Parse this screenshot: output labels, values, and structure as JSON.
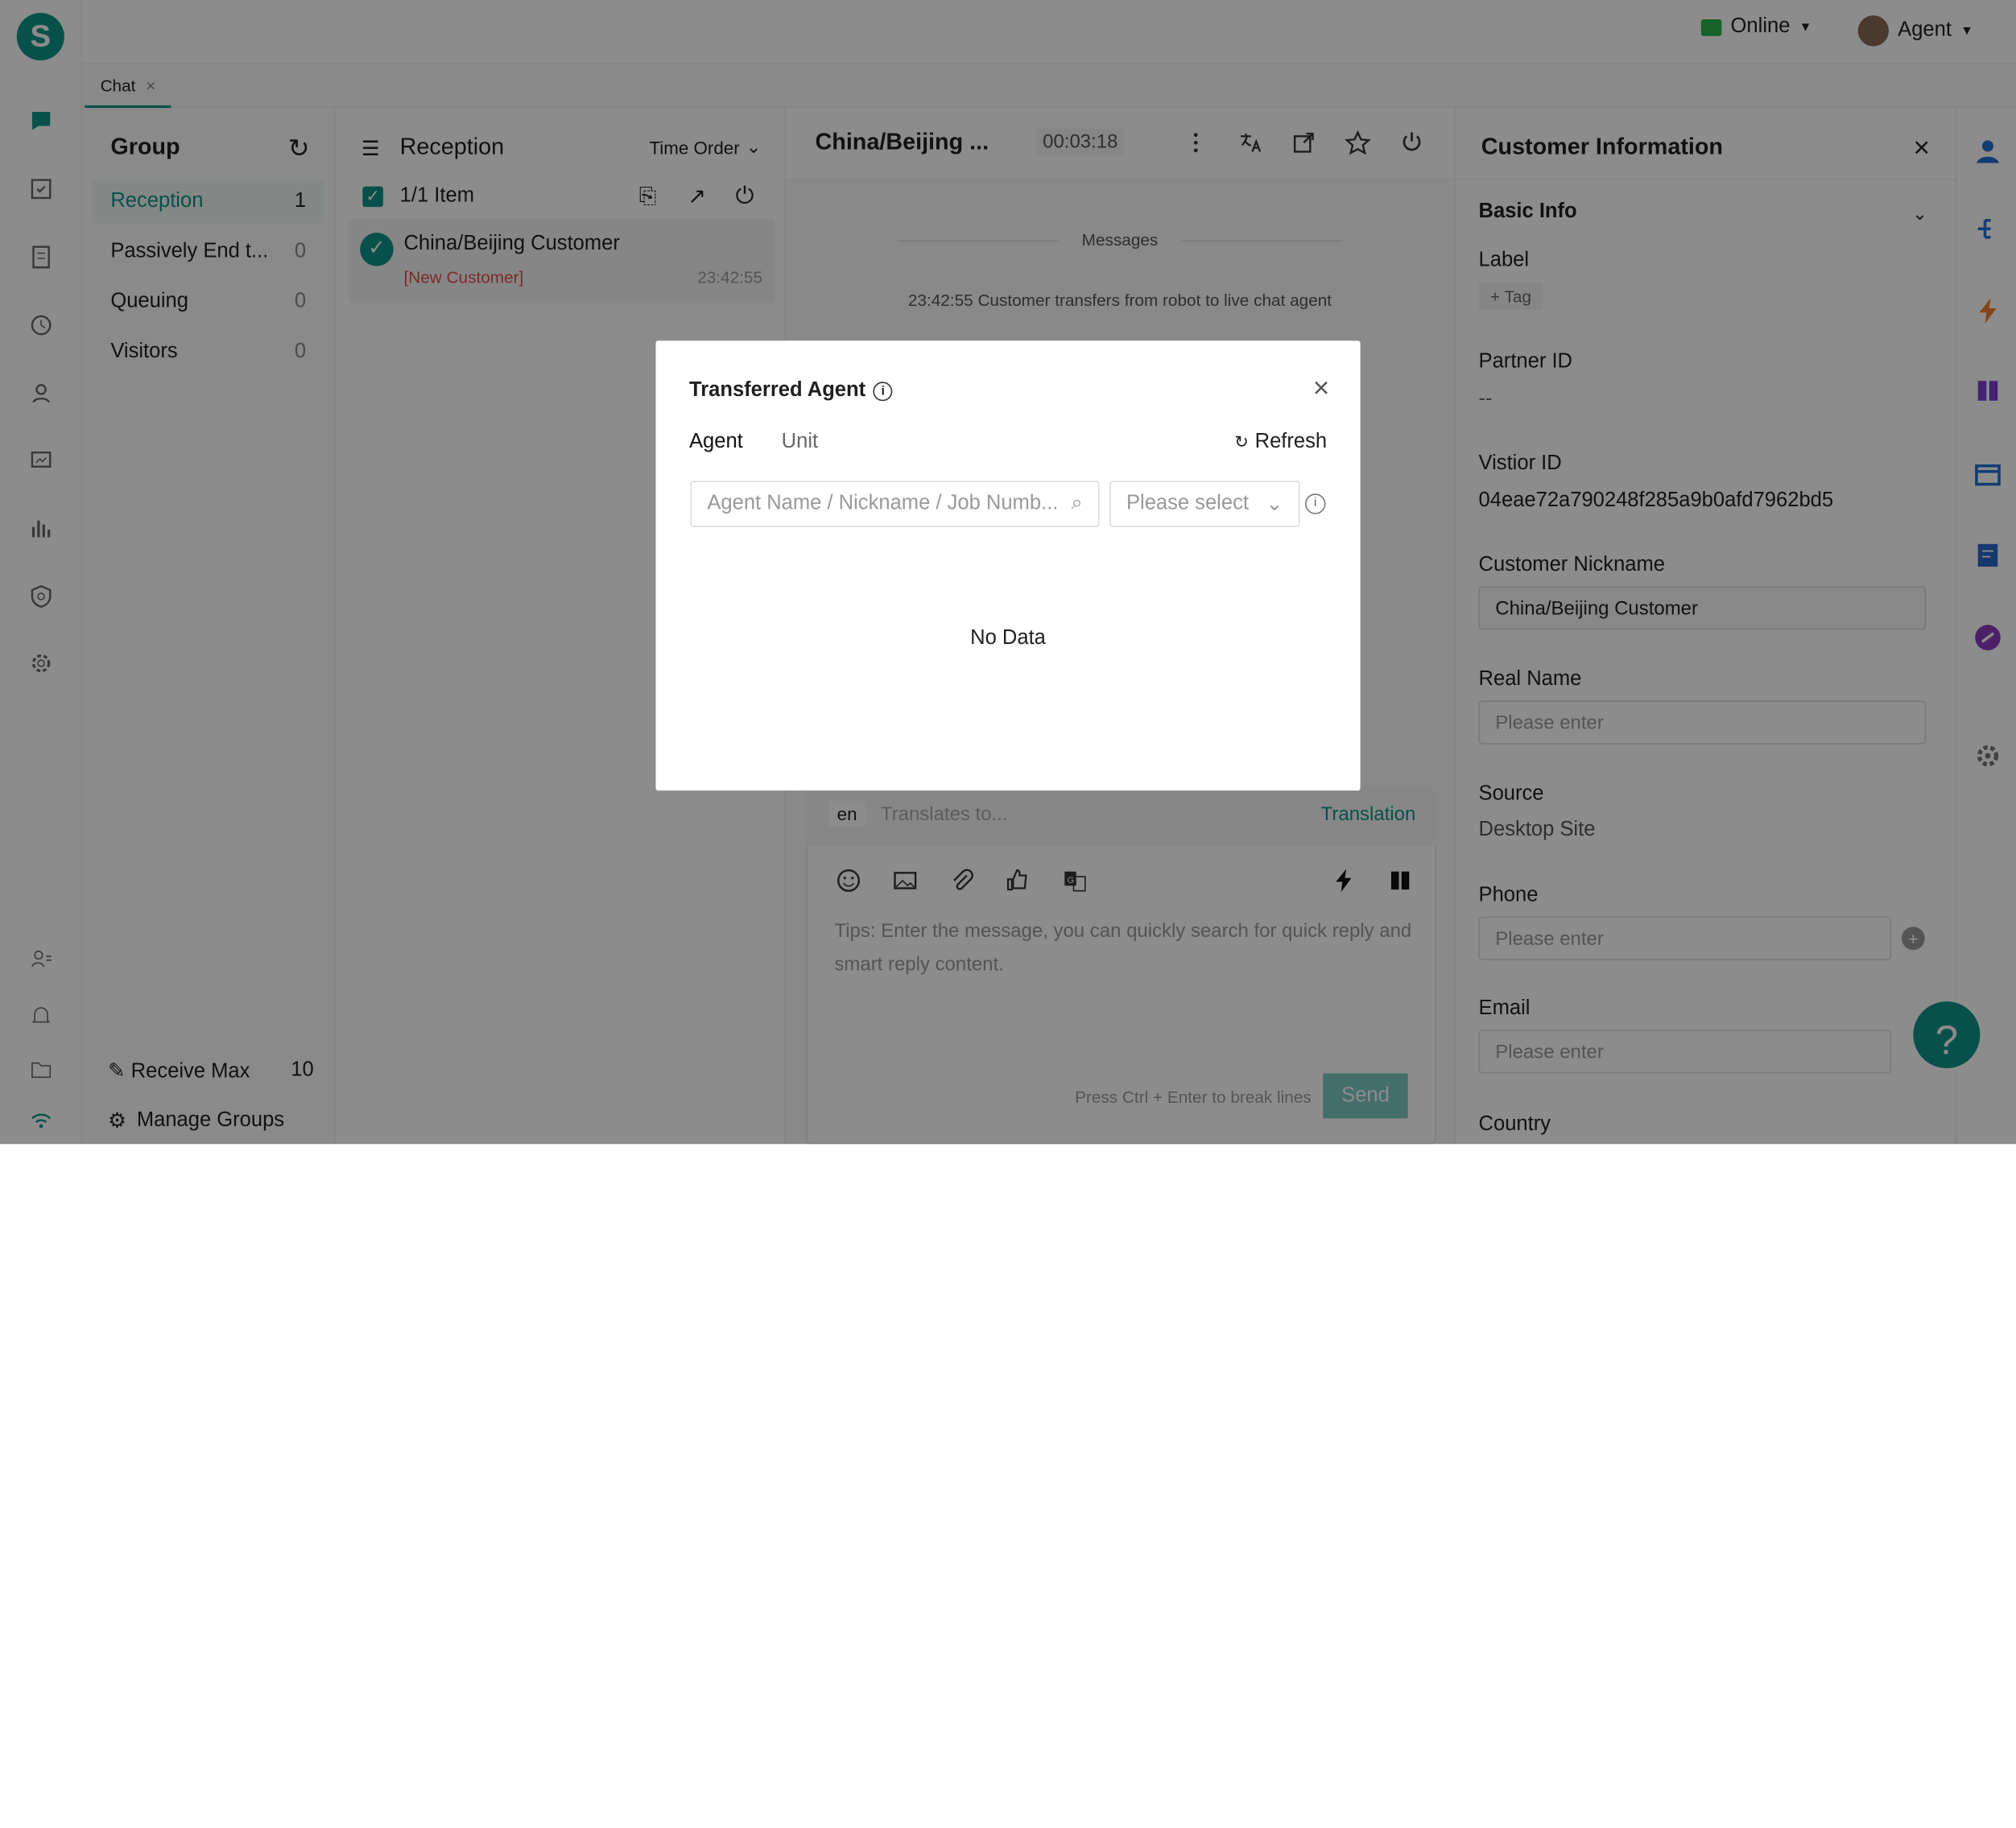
{
  "app": {
    "status": "Online",
    "agent_name": "Agent",
    "tab_label": "Chat"
  },
  "groups": {
    "title": "Group",
    "items": [
      {
        "label": "Reception",
        "count": "1"
      },
      {
        "label": "Passively End t...",
        "count": "0"
      },
      {
        "label": "Queuing",
        "count": "0"
      },
      {
        "label": "Visitors",
        "count": "0"
      }
    ],
    "receive_max_label": "Receive Max",
    "receive_max_value": "10",
    "manage_groups_label": "Manage Groups"
  },
  "reception": {
    "title": "Reception",
    "sort_label": "Time Order",
    "item_count": "1/1 Item",
    "customer": {
      "name": "China/Beijing Customer",
      "tag": "[New Customer]",
      "time": "23:42:55"
    }
  },
  "chat": {
    "title": "China/Beijing ...",
    "timer": "00:03:18",
    "messages_divider": "Messages",
    "system_message": "23:42:55 Customer transfers from robot to live chat agent",
    "language": "en",
    "translate_placeholder": "Translates to...",
    "translation_label": "Translation",
    "tips": "Tips: Enter the message, you can quickly search for quick reply and smart reply content.",
    "break_hint": "Press Ctrl + Enter to break lines",
    "send_label": "Send"
  },
  "customer_info": {
    "title": "Customer Information",
    "section": "Basic Info",
    "label_title": "Label",
    "tag_button": "+ Tag",
    "partner_id_label": "Partner ID",
    "partner_id_value": "--",
    "visitor_id_label": "Vistior ID",
    "visitor_id_value": "04eae72a790248f285a9b0afd7962bd5",
    "nickname_label": "Customer Nickname",
    "nickname_value": "China/Beijing Customer",
    "real_name_label": "Real Name",
    "real_name_placeholder": "Please enter",
    "source_label": "Source",
    "source_value": "Desktop Site",
    "phone_label": "Phone",
    "phone_placeholder": "Please enter",
    "email_label": "Email",
    "email_placeholder": "Please enter",
    "country_label": "Country"
  },
  "modal": {
    "title": "Transferred Agent",
    "tabs": [
      "Agent",
      "Unit"
    ],
    "refresh_label": "Refresh",
    "search_placeholder": "Agent Name / Nickname / Job Numb...",
    "select_placeholder": "Please select",
    "empty_text": "No Data"
  },
  "help_label": "?"
}
